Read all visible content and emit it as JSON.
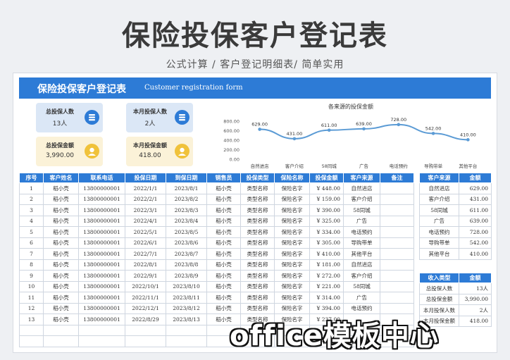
{
  "page": {
    "title": "保险投保客户登记表",
    "subtitle": "公式计算 / 客户登记明细表/ 简单实用",
    "watermark": "office模板中心"
  },
  "banner": {
    "title_cn": "保险投保客户登记表",
    "title_en": "Customer registration form"
  },
  "cards": [
    {
      "label": "总投保人数",
      "value": "13人",
      "icon": "coin-stack-icon"
    },
    {
      "label": "本月投保人数",
      "value": "2人",
      "icon": "coin-stack-icon"
    },
    {
      "label": "总投保金额",
      "value": "3,990.00",
      "icon": "money-bag-icon"
    },
    {
      "label": "本月投保金额",
      "value": "418.00",
      "icon": "money-bag-icon"
    }
  ],
  "colors": {
    "accent": "#2d7bd6",
    "card_blue": "#dbe7f6",
    "card_yellow": "#fbf2d8",
    "line": "#5b9bd5"
  },
  "chart_data": {
    "type": "line",
    "title": "各来源的投保金额",
    "categories": [
      "自然进店",
      "客户介绍",
      "58同城",
      "广告",
      "电话预约",
      "导购带单",
      "其他平台"
    ],
    "values": [
      629,
      431,
      611,
      639,
      728,
      542,
      410
    ],
    "value_labels": [
      "629.00",
      "431.00",
      "611.00",
      "639.00",
      "728.00",
      "542.00",
      "410.00"
    ],
    "y_ticks": [
      "800.00",
      "600.00",
      "400.00",
      "200.00",
      "0.00"
    ],
    "ylim": [
      0,
      800
    ],
    "grid": false,
    "legend": "none"
  },
  "main_table": {
    "headers": [
      "序号",
      "客户姓名",
      "联系电话",
      "投保日期",
      "到保日期",
      "销售员",
      "投保类型",
      "保险名称",
      "投保金额",
      "客户来源",
      "备注"
    ],
    "rows": [
      [
        "1",
        "稻小壳",
        "13800000001",
        "2022/1/1",
        "2023/8/1",
        "稻小壳",
        "类型名称",
        "保险名字",
        "¥ 448.00",
        "自然进店",
        ""
      ],
      [
        "2",
        "稻小壳",
        "13800000001",
        "2022/2/1",
        "2023/8/2",
        "稻小壳",
        "类型名称",
        "保险名字",
        "¥ 159.00",
        "客户介绍",
        ""
      ],
      [
        "3",
        "稻小壳",
        "13800000001",
        "2022/3/1",
        "2023/8/3",
        "稻小壳",
        "类型名称",
        "保险名字",
        "¥ 390.00",
        "58同城",
        ""
      ],
      [
        "4",
        "稻小壳",
        "13800000001",
        "2022/4/1",
        "2023/8/4",
        "稻小壳",
        "类型名称",
        "保险名字",
        "¥ 325.00",
        "广告",
        ""
      ],
      [
        "5",
        "稻小壳",
        "13800000001",
        "2022/5/1",
        "2023/8/5",
        "稻小壳",
        "类型名称",
        "保险名字",
        "¥ 334.00",
        "电话预约",
        ""
      ],
      [
        "6",
        "稻小壳",
        "13800000001",
        "2022/6/1",
        "2023/8/6",
        "稻小壳",
        "类型名称",
        "保险名字",
        "¥ 305.00",
        "导购带单",
        ""
      ],
      [
        "7",
        "稻小壳",
        "13800000001",
        "2022/7/1",
        "2023/8/7",
        "稻小壳",
        "类型名称",
        "保险名字",
        "¥ 410.00",
        "其他平台",
        ""
      ],
      [
        "8",
        "稻小壳",
        "13800000001",
        "2022/8/1",
        "2023/8/8",
        "稻小壳",
        "类型名称",
        "保险名字",
        "¥ 181.00",
        "自然进店",
        ""
      ],
      [
        "9",
        "稻小壳",
        "13800000001",
        "2022/9/1",
        "2023/8/9",
        "稻小壳",
        "类型名称",
        "保险名字",
        "¥ 272.00",
        "客户介绍",
        ""
      ],
      [
        "10",
        "稻小壳",
        "13800000001",
        "2022/10/1",
        "2023/8/10",
        "稻小壳",
        "类型名称",
        "保险名字",
        "¥ 221.00",
        "58同城",
        ""
      ],
      [
        "11",
        "稻小壳",
        "13800000001",
        "2022/11/1",
        "2023/8/11",
        "稻小壳",
        "类型名称",
        "保险名字",
        "¥ 314.00",
        "广告",
        ""
      ],
      [
        "12",
        "稻小壳",
        "13800000001",
        "2022/12/1",
        "2023/8/12",
        "稻小壳",
        "类型名称",
        "保险名字",
        "¥ 394.00",
        "电话预约",
        ""
      ],
      [
        "13",
        "稻小壳",
        "13800000001",
        "2022/8/29",
        "2023/8/13",
        "稻小壳",
        "类型名称",
        "保险名字",
        "¥ 237.00",
        "",
        ""
      ],
      [
        "",
        "",
        "",
        "",
        "",
        "",
        "",
        "",
        "",
        "",
        ""
      ],
      [
        "",
        "",
        "",
        "",
        "",
        "",
        "",
        "",
        "",
        "",
        ""
      ]
    ]
  },
  "source_table": {
    "headers": [
      "客户来源",
      "金额"
    ],
    "rows": [
      [
        "自然进店",
        "629.00"
      ],
      [
        "客户介绍",
        "431.00"
      ],
      [
        "58同城",
        "611.00"
      ],
      [
        "广告",
        "639.00"
      ],
      [
        "电话预约",
        "728.00"
      ],
      [
        "导购带单",
        "542.00"
      ],
      [
        "其他平台",
        "410.00"
      ]
    ]
  },
  "income_table": {
    "headers": [
      "收入类型",
      "金额"
    ],
    "rows": [
      [
        "总投保人数",
        "13人"
      ],
      [
        "总投保金额",
        "3,990.00"
      ],
      [
        "本月投保人数",
        "2人"
      ],
      [
        "本月投保金额",
        "418.00"
      ]
    ]
  }
}
